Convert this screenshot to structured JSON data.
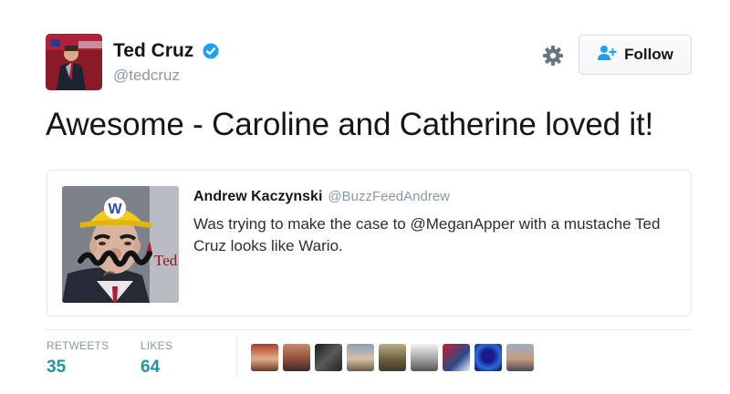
{
  "author": {
    "display_name": "Ted Cruz",
    "handle": "@tedcruz",
    "avatar_icon": "user-avatar-photo",
    "verified_icon": "verified-badge-icon",
    "verified_color": "#1da1f2"
  },
  "header": {
    "settings_icon": "gear-icon",
    "follow_label": "Follow",
    "follow_icon": "person-add-icon"
  },
  "tweet": {
    "text": "Awesome - Caroline and Catherine loved it!"
  },
  "quoted_tweet": {
    "display_name": "Andrew Kaczynski",
    "handle": "@BuzzFeedAndrew",
    "text": "Was trying to make the case to @MeganApper with a mustache Ted Cruz looks like Wario.",
    "image_icon": "wario-edited-photo",
    "image_caption_fragment": "Ted",
    "hat_letter": "W"
  },
  "stats": {
    "retweets_label": "RETWEETS",
    "retweets_value": "35",
    "likes_label": "LIKES",
    "likes_value": "64"
  },
  "likers_count_shown": 9,
  "colors": {
    "accent": "#1b95a8",
    "muted": "#8899a6",
    "text": "#14171a"
  }
}
